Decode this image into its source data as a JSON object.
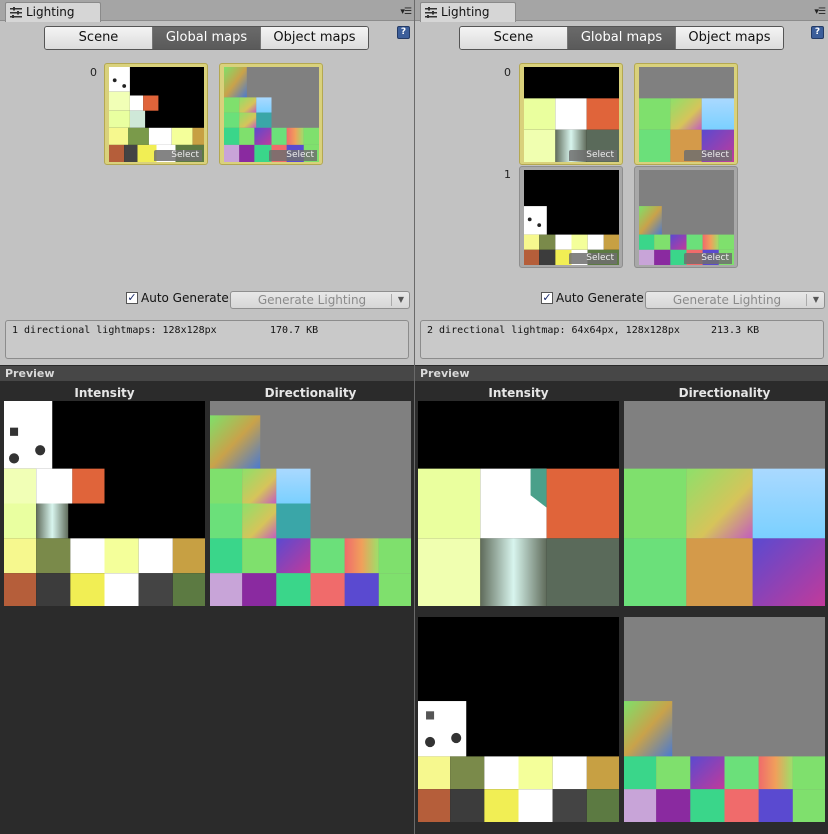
{
  "left": {
    "tab": {
      "title": "Lighting",
      "icon": "lighting-settings-icon"
    },
    "modes": {
      "scene": "Scene",
      "global_maps": "Global maps",
      "object_maps": "Object maps",
      "active": "Global maps"
    },
    "row_labels": [
      "0"
    ],
    "select_label": "Select",
    "auto_generate": {
      "label": "Auto Generate",
      "checked": true
    },
    "generate_button": "Generate Lighting",
    "info": {
      "summary": "1 directional lightmaps: 128x128px",
      "size": "170.7 KB"
    },
    "preview": {
      "title": "Preview",
      "intensity": "Intensity",
      "directionality": "Directionality"
    }
  },
  "right": {
    "tab": {
      "title": "Lighting",
      "icon": "lighting-settings-icon"
    },
    "modes": {
      "scene": "Scene",
      "global_maps": "Global maps",
      "object_maps": "Object maps",
      "active": "Global maps"
    },
    "row_labels": [
      "0",
      "1"
    ],
    "select_label": "Select",
    "auto_generate": {
      "label": "Auto Generate",
      "checked": true
    },
    "generate_button": "Generate Lighting",
    "info": {
      "summary": "2 directional lightmap: 64x64px, 128x128px",
      "size": "213.3 KB"
    },
    "preview": {
      "title": "Preview",
      "intensity": "Intensity",
      "directionality": "Directionality"
    }
  },
  "colors": {
    "panel_bg": "#c2c2c2",
    "selected_thumb_border": "#d9d17c",
    "active_segment": "#5f5f5f",
    "preview_bg": "#2b2b2b",
    "directionality_bg": "#808080"
  }
}
